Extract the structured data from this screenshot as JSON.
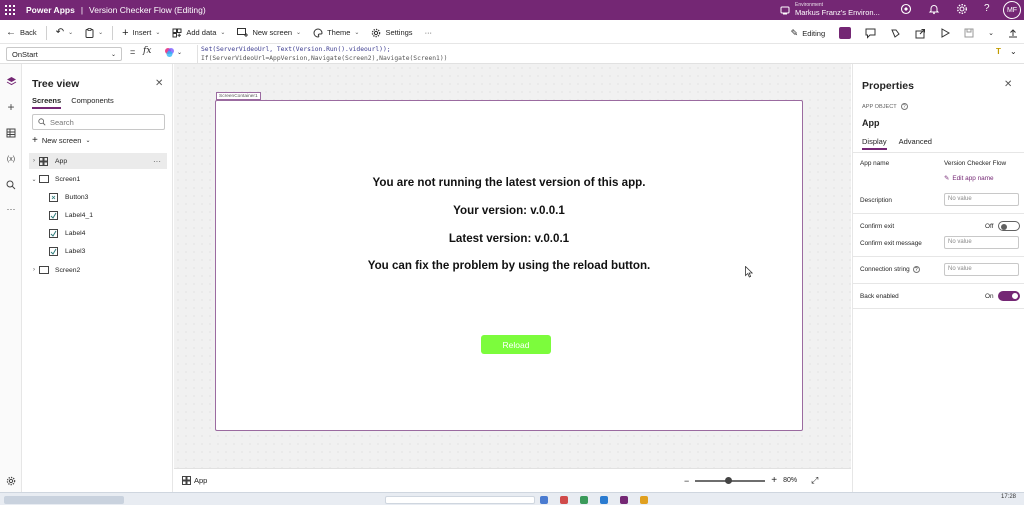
{
  "titlebar": {
    "app_name": "Power Apps",
    "separator": "|",
    "document_title": "Version Checker Flow (Editing)",
    "environment_label": "Environment",
    "environment_name": "Markus Franz's Environ...",
    "avatar_initials": "MF"
  },
  "commandbar": {
    "back": "Back",
    "insert": "Insert",
    "add_data": "Add data",
    "new_screen": "New screen",
    "theme": "Theme",
    "settings": "Settings",
    "more": "···",
    "editing": "Editing"
  },
  "formulabar": {
    "property": "OnStart",
    "equals": "=",
    "fx": "fx",
    "line1": "Set(ServerVideoUrl, Text(Version.Run().videourl));",
    "line2": "If(ServerVideoUrl=AppVersion,Navigate(Screen2),Navigate(Screen1))"
  },
  "treeview": {
    "title": "Tree view",
    "tabs": [
      "Screens",
      "Components"
    ],
    "search_placeholder": "Search",
    "new_screen": "New screen",
    "nodes": [
      {
        "label": "App"
      },
      {
        "label": "Screen1"
      },
      {
        "label": "Button3"
      },
      {
        "label": "Label4_1"
      },
      {
        "label": "Label4"
      },
      {
        "label": "Label3"
      },
      {
        "label": "Screen2"
      }
    ],
    "more": "···"
  },
  "canvas": {
    "screen_tag": "ScreenContainer1",
    "line1": "You are not running the latest version of this app.",
    "line2": "Your version: v.0.0.1",
    "line3": "Latest version: v.0.0.1",
    "line4": "You can fix the problem by using the reload button.",
    "reload_button": "Reload",
    "reload_color": "#7CFC3C"
  },
  "bottombar": {
    "breadcrumb": "App",
    "zoom_minus": "−",
    "zoom_plus": "+",
    "zoom_level": "80%",
    "zoom_fraction": 0.47
  },
  "properties": {
    "title": "Properties",
    "object_type": "APP OBJECT",
    "object_name": "App",
    "tabs": [
      "Display",
      "Advanced"
    ],
    "app_name_label": "App name",
    "app_name_value": "Version Checker Flow",
    "edit_app_name": "Edit app name",
    "description_label": "Description",
    "description_placeholder": "No value",
    "confirm_exit_label": "Confirm exit",
    "confirm_exit_state": "Off",
    "confirm_exit_message_label": "Confirm exit message",
    "confirm_exit_message_placeholder": "No value",
    "connection_string_label": "Connection string",
    "connection_string_placeholder": "No value",
    "back_enabled_label": "Back enabled",
    "back_enabled_state": "On"
  },
  "taskbar": {
    "time": "17:28"
  },
  "colors": {
    "brand": "#742774",
    "toggle_on": "#742774"
  }
}
